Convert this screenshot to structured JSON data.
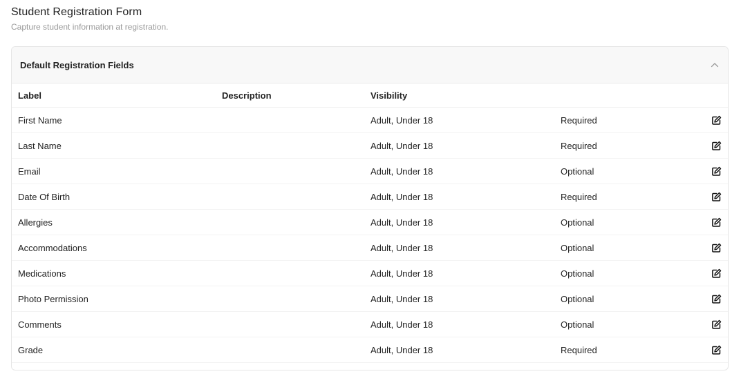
{
  "page": {
    "title": "Student Registration Form",
    "subtitle": "Capture student information at registration."
  },
  "panel": {
    "title": "Default Registration Fields",
    "collapse_icon": "chevron-up-icon"
  },
  "table": {
    "headers": {
      "label": "Label",
      "description": "Description",
      "visibility": "Visibility"
    },
    "edit_icon": "edit-icon",
    "rows": [
      {
        "label": "First Name",
        "description": "",
        "visibility": "Adult, Under 18",
        "requirement": "Required"
      },
      {
        "label": "Last Name",
        "description": "",
        "visibility": "Adult, Under 18",
        "requirement": "Required"
      },
      {
        "label": "Email",
        "description": "",
        "visibility": "Adult, Under 18",
        "requirement": "Optional"
      },
      {
        "label": "Date Of Birth",
        "description": "",
        "visibility": "Adult, Under 18",
        "requirement": "Required"
      },
      {
        "label": "Allergies",
        "description": "",
        "visibility": "Adult, Under 18",
        "requirement": "Optional"
      },
      {
        "label": "Accommodations",
        "description": "",
        "visibility": "Adult, Under 18",
        "requirement": "Optional"
      },
      {
        "label": "Medications",
        "description": "",
        "visibility": "Adult, Under 18",
        "requirement": "Optional"
      },
      {
        "label": "Photo Permission",
        "description": "",
        "visibility": "Adult, Under 18",
        "requirement": "Optional"
      },
      {
        "label": "Comments",
        "description": "",
        "visibility": "Adult, Under 18",
        "requirement": "Optional"
      },
      {
        "label": "Grade",
        "description": "",
        "visibility": "Adult, Under 18",
        "requirement": "Required"
      }
    ]
  },
  "colors": {
    "header_bg": "#f8f8f8",
    "border": "#e6e6e6",
    "text": "#222222",
    "muted": "#9a9a9a"
  }
}
